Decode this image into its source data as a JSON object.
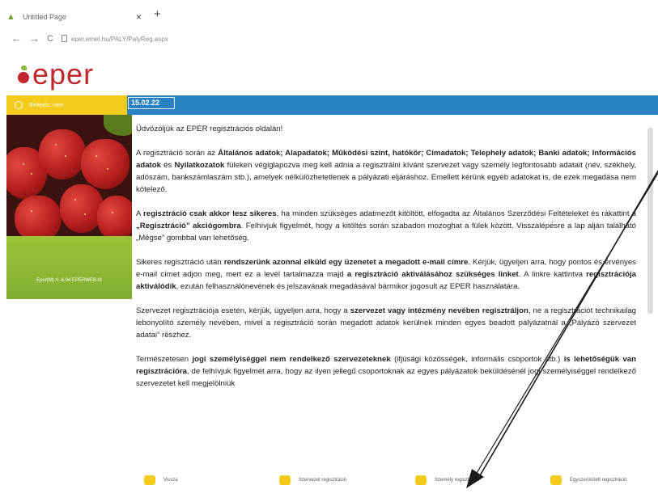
{
  "browser": {
    "tab_title": "Untitled Page",
    "tab_close": "×",
    "new_tab": "+",
    "back": "←",
    "forward": "→",
    "reload": "C",
    "url": "eper.emet.hu/PALY/PalyReg.aspx"
  },
  "header": {
    "logo_text": "eper",
    "date": "15.02.22",
    "user_label": "Belépés: nem"
  },
  "sidebar": {
    "version_code": "Eper(M) V.-6.04 EPERWEB-III"
  },
  "content": {
    "p1": "Üdvözöljük az EPER regisztrációs oldalán!",
    "p2": {
      "t1": "A regisztráció során az ",
      "b1": "Általános adatok; Alapadatok; Működési színt, hatókör; Címadatok; Telephely adatok; Banki adatok; Információs adatok",
      "t2": " és ",
      "b2": "Nyilatkozatok",
      "t3": " füleken végiglapozva meg kell adnia a regisztrálni kívánt szervezet vagy személy legfontosabb adatait (név, székhely, adószám, bankszámlaszám stb.), amelyek nélkülözhetetlenek a pályázati eljáráshoz. Emellett kérünk egyéb adatokat is, de ezek megadása nem kötelező."
    },
    "p3": {
      "t1": "A ",
      "b1": "regisztráció csak akkor lesz sikeres",
      "t2": ", ha minden szükséges adatmezőt kitöltött, elfogadta az Általános Szerződési Feltételeket és rákattint a ",
      "b2": "„Regisztráció” akciógombra",
      "t3": ". Felhívjuk figyelmét, hogy a kitöltés során szabadon mozoghat a fülek között. Visszalépésre a lap alján található „Mégse” gombbal van lehetőség."
    },
    "p4": {
      "t1": "Sikeres regisztráció után ",
      "b1": "rendszerünk azonnal elküld egy üzenetet a megadott e-mail címre",
      "t2": ". Kérjük, ügyeljen arra, hogy pontos és érvényes e-mail címet adjon meg, mert ez a levél tartalmazza majd ",
      "b2": "a regisztráció aktiválásához szükséges linket",
      "t3": ". A linkre kattintva ",
      "b3": "regisztrációja aktiválódik",
      "t4": ", ezután felhasználónevének és jelszavának megadásával bármikor jogosult az EPER használatára."
    },
    "p5": {
      "t1": "Szervezet regisztrációja esetén, kérjük, ügyeljen arra, hogy a ",
      "b1": "szervezet vagy intézmény nevében regisztráljon",
      "t2": ", ne a regisztrációt technikailag lebonyolító személy nevében, mivel a regisztráció során megadott adatok kerülnek minden egyes beadott pályázatnál a „Pályázó szervezet adatai” részhez."
    },
    "p6": {
      "t1": "Természetesen ",
      "b1": "jogi személyiséggel nem rendelkező szervezeteknek",
      "t2": " (ifjúsági közösségek, informális csoportok stb.) ",
      "b2": "is lehetőségük van regisztrációra",
      "t3": ", de felhívjuk figyelmét arra, hogy az ilyen jellegű csoportoknak az egyes pályázatok beküldésénél jogi személyiséggel rendelkező szervezetet kell megjelölniük"
    }
  },
  "footer": {
    "back": "Vissza",
    "org_reg": "Szervezet regisztráció",
    "person_reg": "Személy regisztráció",
    "sole_reg": "Egyszerűsített regisztráció"
  },
  "colors": {
    "brand_red": "#c1272d",
    "bar_blue": "#2a82c4",
    "bar_yellow": "#f5cb1b",
    "panel_green": "#8bb834"
  }
}
